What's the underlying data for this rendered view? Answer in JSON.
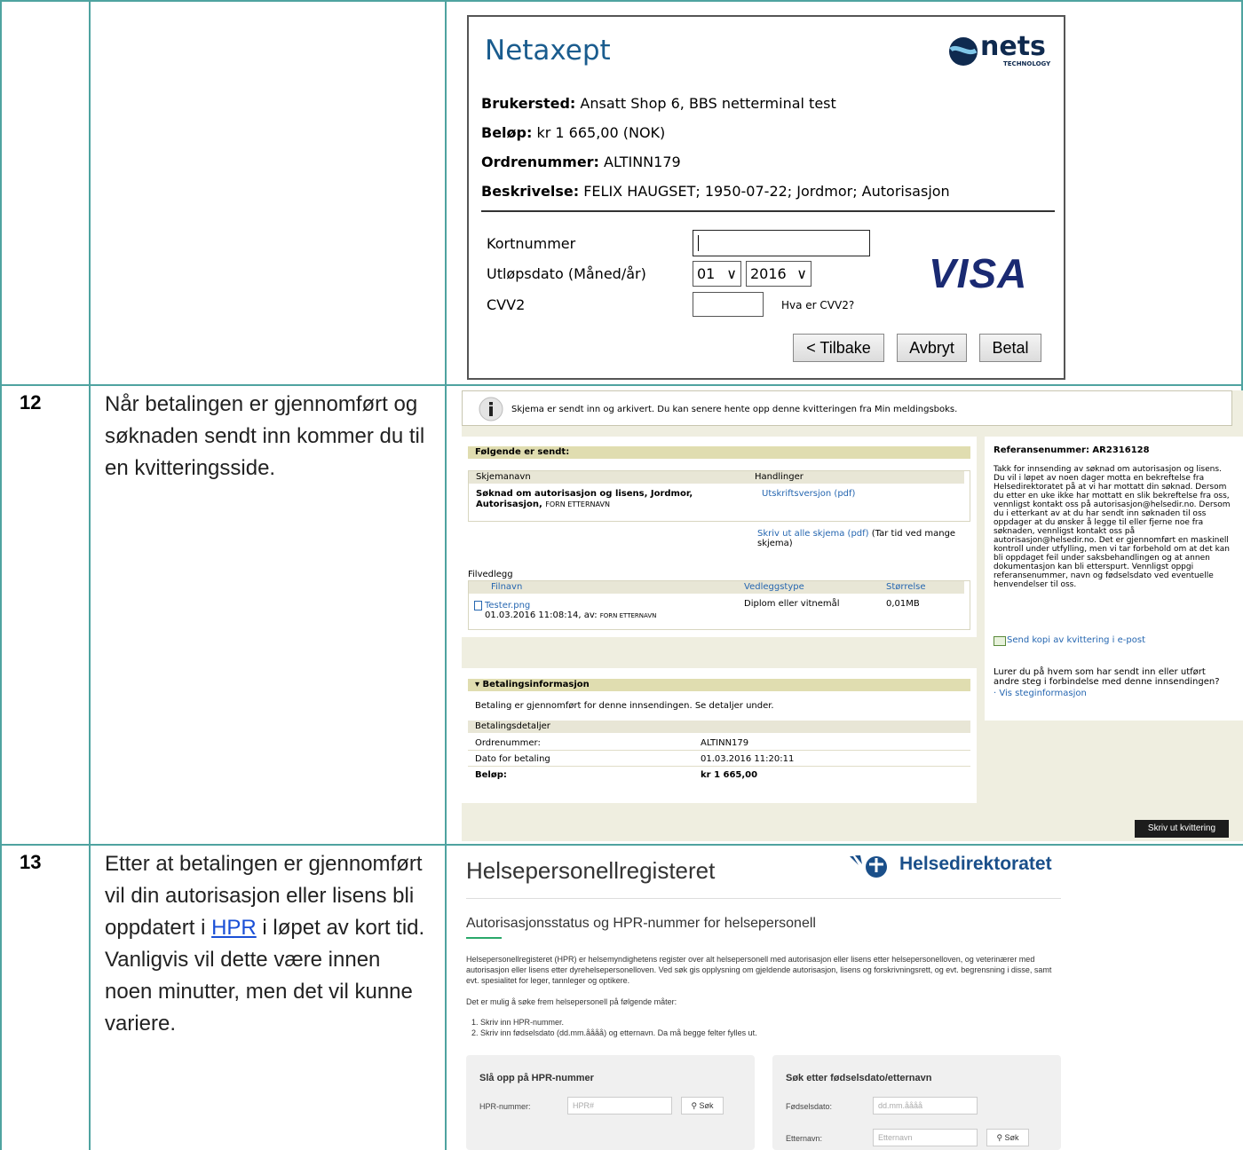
{
  "steps": {
    "step12": {
      "number": "12",
      "text": "Når betalingen er gjennomført og søknaden sendt inn kommer du til en kvitteringsside."
    },
    "step13": {
      "number": "13",
      "text_before": "Etter at betalingen er gjennomført vil din autorisasjon eller lisens bli oppdatert i ",
      "link": "HPR",
      "text_after": " i løpet av kort tid. Vanligvis vil dette være innen noen minutter, men det vil kunne variere."
    }
  },
  "netaxept": {
    "title": "Netaxept",
    "logo_text": "nets",
    "logo_sub": "TECHNOLOGY",
    "brukersted_label": "Brukersted:",
    "brukersted_value": "Ansatt Shop 6, BBS netterminal test",
    "belop_label": "Beløp:",
    "belop_value": "kr 1 665,00 (NOK)",
    "ordre_label": "Ordrenummer:",
    "ordre_value": "ALTINN179",
    "beskr_label": "Beskrivelse:",
    "beskr_value": "FELIX HAUGSET; 1950-07-22; Jordmor; Autorisasjon",
    "kortnummer_label": "Kortnummer",
    "utlop_label": "Utløpsdato (Måned/år)",
    "cvv_label": "CVV2",
    "month": "01",
    "year": "2016",
    "cvv_help": "Hva er CVV2?",
    "visa": "VISA",
    "btn_back": "< Tilbake",
    "btn_cancel": "Avbryt",
    "btn_pay": "Betal"
  },
  "receipt": {
    "info_text": "Skjema er sendt inn og arkivert. Du kan senere hente opp denne kvitteringen fra Min meldingsboks.",
    "sent_header": "Følgende er sendt:",
    "col_schema": "Skjemanavn",
    "col_actions": "Handlinger",
    "schema_name": "Søknad om autorisasjon og lisens, Jordmor, Autorisasjon,",
    "schema_person": "FORN ETTERNAVN",
    "print_version": "Utskriftsversjon (pdf)",
    "print_all_link": "Skriv ut alle skjema (pdf)",
    "print_all_note": "(Tar tid ved mange skjema)",
    "attachments_label": "Filvedlegg",
    "col_file": "Filnavn",
    "col_type": "Vedleggstype",
    "col_size": "Størrelse",
    "file_name": "Tester.png",
    "file_meta": "01.03.2016 11:08:14, av:",
    "file_person": "FORN ETTERNAVN",
    "file_type": "Diplom eller vitnemål",
    "file_size": "0,01MB",
    "pay_header": "▾ Betalingsinformasjon",
    "pay_text": "Betaling er gjennomført for denne innsendingen. Se detaljer under.",
    "pay_details": "Betalingsdetaljer",
    "rows": [
      {
        "label": "Ordrenummer:",
        "value": "ALTINN179"
      },
      {
        "label": "Dato for betaling",
        "value": "01.03.2016 11:20:11"
      },
      {
        "label": "Beløp:",
        "value": "kr 1 665,00"
      }
    ],
    "ref_title": "Referansenummer: AR2316128",
    "ref_text": "Takk for innsending av søknad om autorisasjon og lisens. Du vil i løpet av noen dager motta en bekreftelse fra Helsedirektoratet på at vi har mottatt din søknad. Dersom du etter en uke ikke har mottatt en slik bekreftelse fra oss, vennligst kontakt oss på autorisasjon@helsedir.no. Dersom du i etterkant av at du har sendt inn søknaden til oss oppdager at du ønsker å legge til eller fjerne noe fra søknaden, vennligst kontakt oss på autorisasjon@helsedir.no. Det er gjennomført en maskinell kontroll under utfylling, men vi tar forbehold om at det kan bli oppdaget feil under saksbehandlingen og at annen dokumentasjon kan bli etterspurt. Vennligst oppgi referansenummer, navn og fødselsdato ved eventuelle henvendelser til oss.",
    "send_copy": "Send kopi av kvittering i e-post",
    "lurer_text": "Lurer du på hvem som har sendt inn eller utført andre steg i forbindelse med denne innsendingen?",
    "vis_steg": "Vis steginformasjon",
    "print_receipt": "Skriv ut kvittering"
  },
  "hpr": {
    "title": "Helsepersonellregisteret",
    "logo": "Helsedirektoratet",
    "subtitle": "Autorisasjonsstatus og HPR-nummer for helsepersonell",
    "para1": "Helsepersonellregisteret (HPR) er helsemyndighetens register over alt helsepersonell med autorisasjon eller lisens etter helsepersonelloven, og veterinærer med autorisasjon eller lisens etter dyrehelsepersonelloven. Ved søk gis opplysning om gjeldende autorisasjon, lisens og forskrivningsrett, og evt. begrensning i disse, samt evt. spesialitet for leger, tannleger og optikere.",
    "para2": "Det er mulig å søke frem helsepersonell på følgende måter:",
    "item1": "1. Skriv inn HPR-nummer.",
    "item2": "2. Skriv inn fødselsdato (dd.mm.åååå) og etternavn. Da må begge felter fylles ut.",
    "panel1_title": "Slå opp på HPR-nummer",
    "hpr_label": "HPR-nummer:",
    "hpr_placeholder": "HPR#",
    "search": "Søk",
    "panel2_title": "Søk etter fødselsdato/etternavn",
    "dob_label": "Fødselsdato:",
    "dob_placeholder": "dd.mm.åååå",
    "surname_label": "Etternavn:",
    "surname_placeholder": "Etternavn"
  }
}
